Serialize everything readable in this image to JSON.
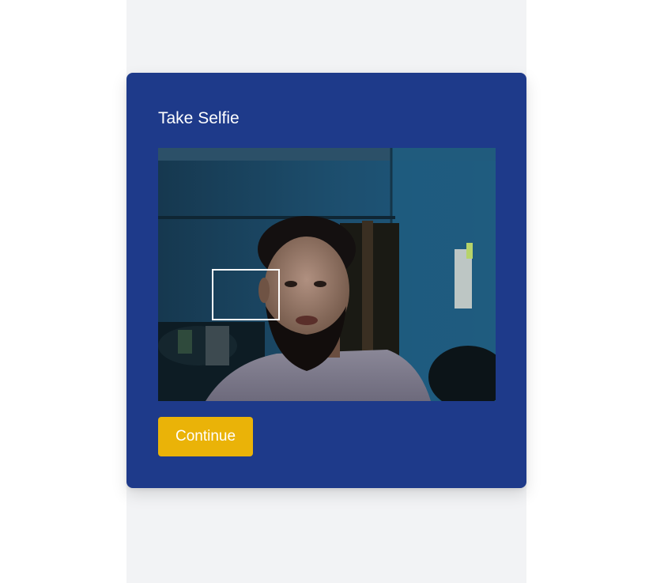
{
  "selfie_card": {
    "title": "Take Selfie",
    "continue_label": "Continue"
  },
  "colors": {
    "card_background": "#1e3a8a",
    "button_background": "#eab308",
    "page_column": "#f2f3f5"
  }
}
